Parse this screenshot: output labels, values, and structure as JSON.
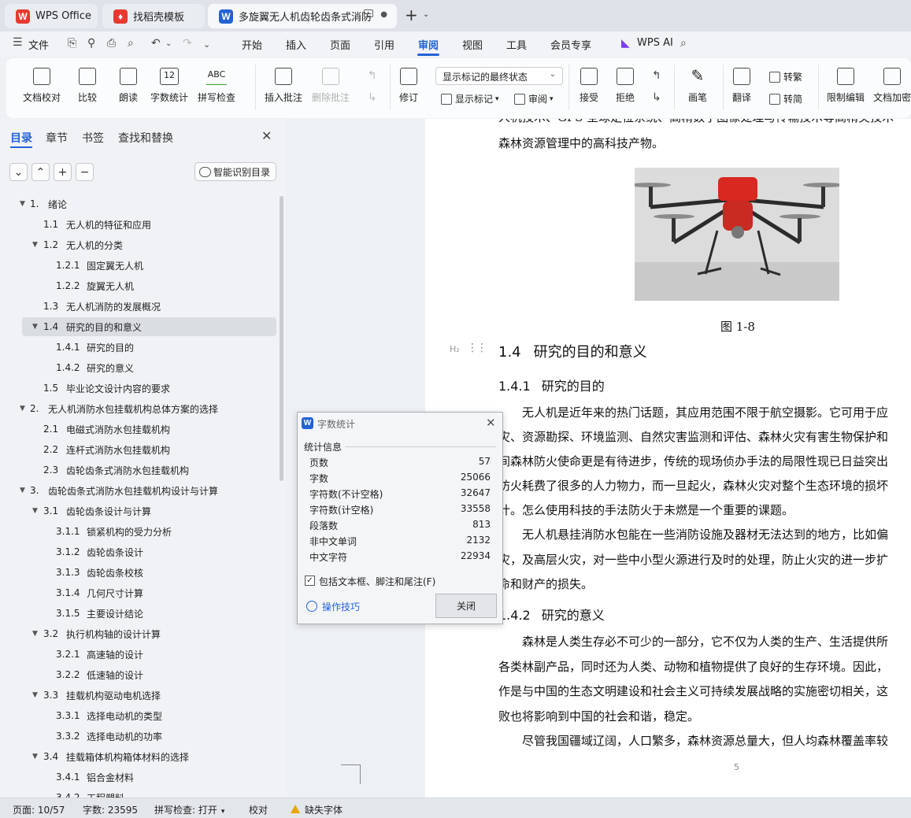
{
  "tabs": [
    {
      "label": "WPS Office"
    },
    {
      "label": "找稻壳模板"
    },
    {
      "label": "多旋翼无人机齿轮齿条式消防"
    }
  ],
  "menu": {
    "file": "文件",
    "items": [
      "开始",
      "插入",
      "页面",
      "引用",
      "审阅",
      "视图",
      "工具",
      "会员专享"
    ],
    "ai": "WPS AI"
  },
  "ribbon": {
    "doc_proof": "文档校对",
    "compare": "比较",
    "read_aloud": "朗读",
    "word_count": "字数统计",
    "spell_check": "拼写检查",
    "word_count_icon": "12",
    "spell_icon": "ABC",
    "insert_comment": "插入批注",
    "delete_comment": "删除批注",
    "revise": "修订",
    "markup_mode": "显示标记的最终状态",
    "show_markup": "显示标记",
    "review": "审阅",
    "accept": "接受",
    "reject": "拒绝",
    "pen": "画笔",
    "translate": "翻译",
    "to_traditional": "转繁",
    "to_simplified": "转简",
    "restrict_edit": "限制编辑",
    "doc_encrypt": "文档加密"
  },
  "nav": {
    "tabs": [
      "目录",
      "章节",
      "书签",
      "查找和替换"
    ],
    "smart_toc": "智能识别目录",
    "toc": [
      {
        "num": "1.",
        "text": "绪论",
        "level": 1,
        "arrow": true
      },
      {
        "num": "1.1",
        "text": "无人机的特征和应用",
        "level": 2,
        "arrow": false
      },
      {
        "num": "1.2",
        "text": "无人机的分类",
        "level": 2,
        "arrow": true
      },
      {
        "num": "1.2.1",
        "text": "固定翼无人机",
        "level": 3,
        "arrow": false
      },
      {
        "num": "1.2.2",
        "text": "旋翼无人机",
        "level": 3,
        "arrow": false
      },
      {
        "num": "1.3",
        "text": "无人机消防的发展概况",
        "level": 2,
        "arrow": false
      },
      {
        "num": "1.4",
        "text": "研究的目的和意义",
        "level": 2,
        "arrow": true,
        "selected": true
      },
      {
        "num": "1.4.1",
        "text": "研究的目的",
        "level": 3,
        "arrow": false
      },
      {
        "num": "1.4.2",
        "text": "研究的意义",
        "level": 3,
        "arrow": false
      },
      {
        "num": "1.5",
        "text": "毕业论文设计内容的要求",
        "level": 2,
        "arrow": false
      },
      {
        "num": "2.",
        "text": "无人机消防水包挂载机构总体方案的选择",
        "level": 1,
        "arrow": true
      },
      {
        "num": "2.1",
        "text": "电磁式消防水包挂载机构",
        "level": 2,
        "arrow": false
      },
      {
        "num": "2.2",
        "text": "连杆式消防水包挂载机构",
        "level": 2,
        "arrow": false
      },
      {
        "num": "2.3",
        "text": "齿轮齿条式消防水包挂载机构",
        "level": 2,
        "arrow": false
      },
      {
        "num": "3.",
        "text": "齿轮齿条式消防水包挂载机构设计与计算",
        "level": 1,
        "arrow": true
      },
      {
        "num": "3.1",
        "text": "齿轮齿条设计与计算",
        "level": 2,
        "arrow": true
      },
      {
        "num": "3.1.1",
        "text": "锁紧机构的受力分析",
        "level": 3,
        "arrow": false
      },
      {
        "num": "3.1.2",
        "text": "齿轮齿条设计",
        "level": 3,
        "arrow": false
      },
      {
        "num": "3.1.3",
        "text": "齿轮齿条校核",
        "level": 3,
        "arrow": false
      },
      {
        "num": "3.1.4",
        "text": "几何尺寸计算",
        "level": 3,
        "arrow": false
      },
      {
        "num": "3.1.5",
        "text": "主要设计结论",
        "level": 3,
        "arrow": false
      },
      {
        "num": "3.2",
        "text": "执行机构轴的设计计算",
        "level": 2,
        "arrow": true
      },
      {
        "num": "3.2.1",
        "text": "高速轴的设计",
        "level": 3,
        "arrow": false
      },
      {
        "num": "3.2.2",
        "text": "低速轴的设计",
        "level": 3,
        "arrow": false
      },
      {
        "num": "3.3",
        "text": "挂载机构驱动电机选择",
        "level": 2,
        "arrow": true
      },
      {
        "num": "3.3.1",
        "text": "选择电动机的类型",
        "level": 3,
        "arrow": false
      },
      {
        "num": "3.3.2",
        "text": "选择电动机的功率",
        "level": 3,
        "arrow": false
      },
      {
        "num": "3.4",
        "text": "挂载箱体机构箱体材料的选择",
        "level": 2,
        "arrow": true
      },
      {
        "num": "3.4.1",
        "text": "铝合金材料",
        "level": 3,
        "arrow": false
      },
      {
        "num": "3.4.2",
        "text": "工程塑料",
        "level": 3,
        "arrow": false
      }
    ]
  },
  "doc": {
    "line_top_cut": "人机技术、GPS 全球定位系统、高精数字图像处理与传输技术等高精尖技术",
    "line_top": "森林资源管理中的高科技产物。",
    "figure_caption": "图 1-8",
    "heading_marker": "H₂",
    "h14_num": "1.4",
    "h14_text": "研究的目的和意义",
    "h141_num": "1.4.1",
    "h141_text": "研究的目的",
    "p1": [
      "　　无人机是近年来的热门话题，其应用范围不限于航空摄影。它可用于应",
      "灾、资源勘探、环境监测、自然灾害监测和评估、森林火灾有害生物保护和",
      "间森林防火使命更是有待进步，传统的现场侦办手法的局限性现已日益突出",
      "防火耗费了很多的人力物力，而一旦起火，森林火灾对整个生态环境的损坏",
      "计。怎么使用科技的手法防火于未燃是一个重要的课题。"
    ],
    "p2": [
      "　　无人机悬挂消防水包能在一些消防设施及器材无法达到的地方，比如偏",
      "灾，及高层火灾，对一些中小型火源进行及时的处理，防止火灾的进一步扩",
      "命和财产的损失。"
    ],
    "h142_num": "1.4.2",
    "h142_text": "研究的意义",
    "p3": [
      "　　森林是人类生存必不可少的一部分，它不仅为人类的生产、生活提供所",
      "各类林副产品，同时还为人类、动物和植物提供了良好的生存环境。因此，",
      "作是与中国的生态文明建设和社会主义可持续发展战略的实施密切相关，这",
      "败也将影响到中国的社会和谐，稳定。",
      "　　尽管我国疆域辽阔，人口繁多，森林资源总量大，但人均森林覆盖率较"
    ],
    "page_number": "5"
  },
  "dialog": {
    "title": "字数统计",
    "group": "统计信息",
    "stats": [
      {
        "label": "页数",
        "value": "57"
      },
      {
        "label": "字数",
        "value": "25066"
      },
      {
        "label": "字符数(不计空格)",
        "value": "32647"
      },
      {
        "label": "字符数(计空格)",
        "value": "33558"
      },
      {
        "label": "段落数",
        "value": "813"
      },
      {
        "label": "非中文单词",
        "value": "2132"
      },
      {
        "label": "中文字符",
        "value": "22934"
      }
    ],
    "include_label": "包括文本框、脚注和尾注(F)",
    "include_checked": true,
    "tips": "操作技巧",
    "close": "关闭"
  },
  "status": {
    "page": "页面: 10/57",
    "words": "字数: 23595",
    "spell": "拼写检查: 打开",
    "proof": "校对",
    "missing_font": "缺失字体"
  }
}
